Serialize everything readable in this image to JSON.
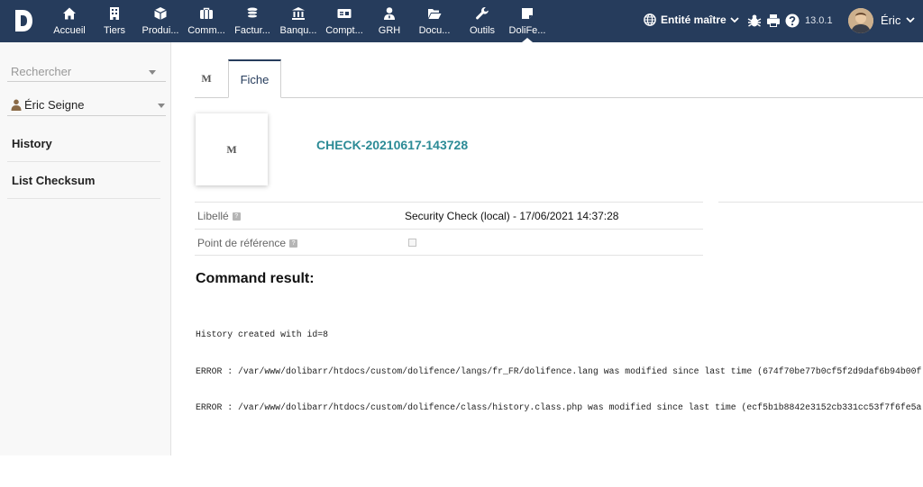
{
  "topbar": {
    "logo_letter": "D",
    "menu": [
      {
        "label": "Accueil",
        "icon": "home-icon"
      },
      {
        "label": "Tiers",
        "icon": "building-icon"
      },
      {
        "label": "Produi...",
        "icon": "cube-icon"
      },
      {
        "label": "Comm...",
        "icon": "briefcase-icon"
      },
      {
        "label": "Factur...",
        "icon": "coins-icon"
      },
      {
        "label": "Banqu...",
        "icon": "bank-icon"
      },
      {
        "label": "Compt...",
        "icon": "money-bill-icon"
      },
      {
        "label": "GRH",
        "icon": "user-tie-icon"
      },
      {
        "label": "Docu...",
        "icon": "folder-open-icon"
      },
      {
        "label": "Outils",
        "icon": "wrench-icon"
      },
      {
        "label": "DoliFe...",
        "icon": "sticky-note-icon",
        "active": true
      }
    ],
    "entity_label": "Entité maître",
    "version": "13.0.1",
    "user_name": "Éric",
    "colors": {
      "bar": "#263c5c",
      "link": "#2c8b96"
    }
  },
  "sidebar": {
    "search_placeholder": "Rechercher",
    "user_select_value": "Éric Seigne",
    "links": [
      {
        "label": "History"
      },
      {
        "label": "List Checksum"
      }
    ]
  },
  "main": {
    "tabs": [
      {
        "label": "M"
      },
      {
        "label": "Fiche",
        "active": true
      }
    ],
    "logo_placeholder": "M",
    "record_ref": "CHECK-20210617-143728",
    "fields": [
      {
        "label": "Libellé",
        "value": "Security Check (local) - 17/06/2021 14:37:28"
      },
      {
        "label": "Point de référence",
        "checked": false
      }
    ],
    "help_glyph": "?",
    "command_result_title": "Command result:",
    "command_output": [
      "History created with id=8",
      "ERROR : /var/www/dolibarr/htdocs/custom/dolifence/langs/fr_FR/dolifence.lang was modified since last time (674f70be77b0cf5f2d9daf6b94b00f",
      "ERROR : /var/www/dolibarr/htdocs/custom/dolifence/class/history.class.php was modified since last time (ecf5b1b8842e3152cb331cc53f7f6fe5a"
    ]
  }
}
